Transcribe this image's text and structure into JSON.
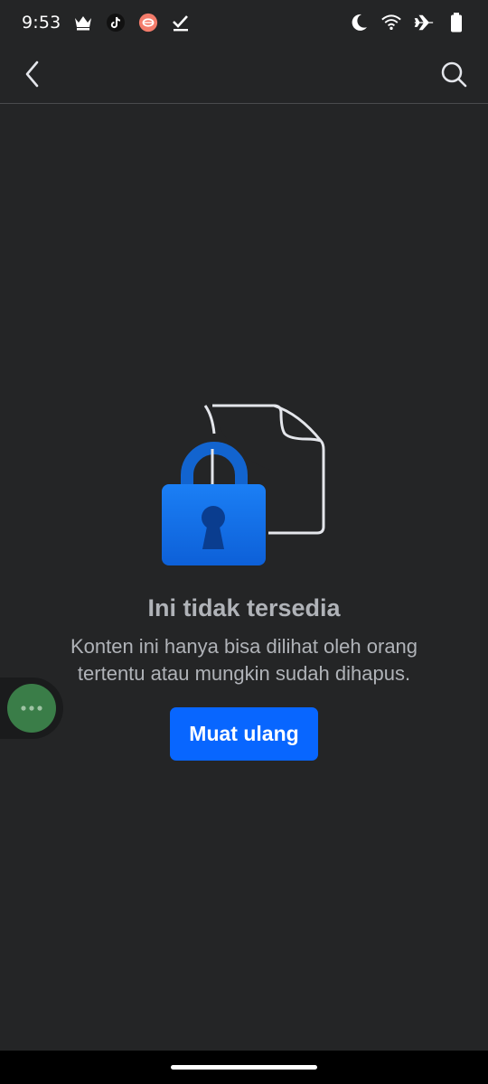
{
  "status_bar": {
    "time": "9:53",
    "left_icons": [
      "crown-icon",
      "tiktok-icon",
      "app-notification-icon",
      "checkmark-icon"
    ],
    "right_icons": [
      "moon-icon",
      "wifi-icon",
      "airplane-icon",
      "battery-icon"
    ]
  },
  "app_bar": {
    "back_icon": "chevron-left-icon",
    "search_icon": "search-icon"
  },
  "content": {
    "illustration_icons": [
      "document-icon",
      "padlock-icon"
    ],
    "title": "Ini tidak tersedia",
    "description": "Konten ini hanya bisa dilihat oleh orang tertentu atau mungkin sudah dihapus.",
    "reload_label": "Muat ulang"
  },
  "colors": {
    "background": "#242526",
    "button": "#0866ff",
    "lock": "#1877f2",
    "bubble": "#3a7d48"
  },
  "floating": {
    "chat_bubble_icon": "more-dots-icon"
  }
}
